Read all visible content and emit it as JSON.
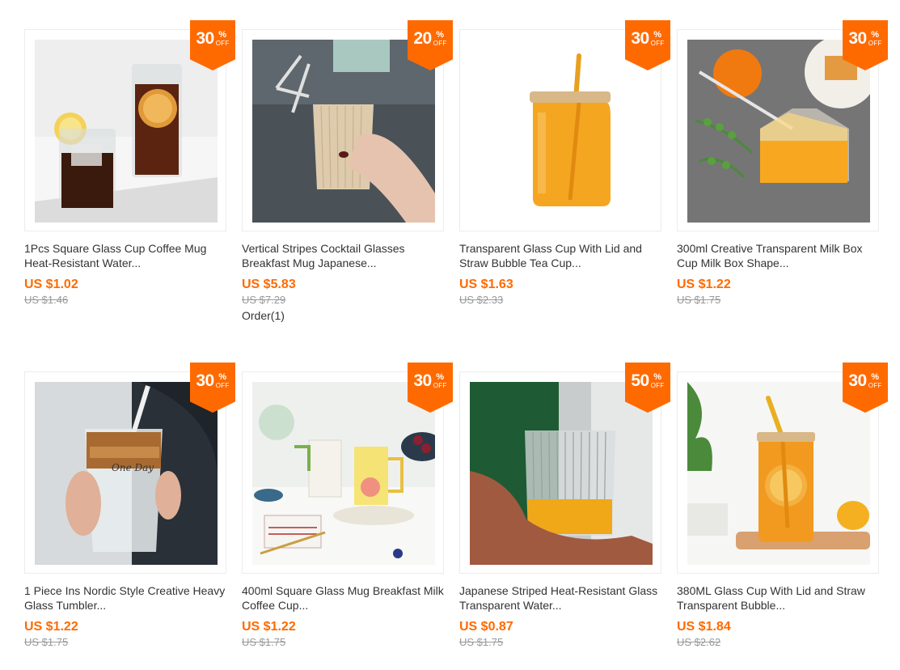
{
  "products": [
    {
      "title": "1Pcs Square Glass Cup Coffee Mug Heat-Resistant Water...",
      "price": "US $1.02",
      "original_price": "US $1.46",
      "discount": "30",
      "orders": ""
    },
    {
      "title": "Vertical Stripes Cocktail Glasses Breakfast Mug Japanese...",
      "price": "US $5.83",
      "original_price": "US $7.29",
      "discount": "20",
      "orders": "Order(1)"
    },
    {
      "title": "Transparent Glass Cup With Lid and Straw Bubble Tea Cup...",
      "price": "US $1.63",
      "original_price": "US $2.33",
      "discount": "30",
      "orders": ""
    },
    {
      "title": "300ml Creative Transparent Milk Box Cup Milk Box Shape...",
      "price": "US $1.22",
      "original_price": "US $1.75",
      "discount": "30",
      "orders": ""
    },
    {
      "title": "1 Piece Ins Nordic Style Creative Heavy Glass Tumbler...",
      "price": "US $1.22",
      "original_price": "US $1.75",
      "discount": "30",
      "orders": ""
    },
    {
      "title": "400ml Square Glass Mug Breakfast Milk Coffee Cup...",
      "price": "US $1.22",
      "original_price": "US $1.75",
      "discount": "30",
      "orders": ""
    },
    {
      "title": "Japanese Striped Heat-Resistant Glass Transparent Water...",
      "price": "US $0.87",
      "original_price": "US $1.75",
      "discount": "50",
      "orders": ""
    },
    {
      "title": "380ML Glass Cup With Lid and Straw Transparent Bubble...",
      "price": "US $1.84",
      "original_price": "US $2.62",
      "discount": "30",
      "orders": ""
    }
  ],
  "badge": {
    "percent": "%",
    "off": "OFF"
  },
  "colors": {
    "accent": "#ff6a00",
    "strike": "#999999",
    "text": "#333333"
  }
}
